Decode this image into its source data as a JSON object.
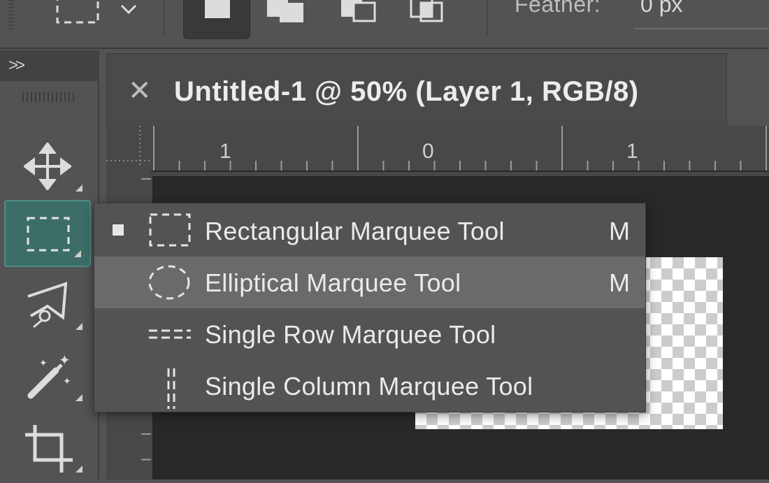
{
  "options_bar": {
    "feather_label": "Feather:",
    "feather_value": "0 px"
  },
  "toolbar": {
    "collapse_toggle": ">>"
  },
  "document": {
    "close_glyph": "✕",
    "title": "Untitled-1 @ 50% (Layer 1, RGB/8)",
    "ruler_labels": [
      "1",
      "0",
      "1"
    ]
  },
  "flyout": {
    "items": [
      {
        "label": "Rectangular Marquee Tool",
        "shortcut": "M",
        "icon": "rect-marquee-icon",
        "active": true
      },
      {
        "label": "Elliptical Marquee Tool",
        "shortcut": "M",
        "icon": "ellipse-marquee-icon",
        "highlighted": true
      },
      {
        "label": "Single Row Marquee Tool",
        "shortcut": "",
        "icon": "single-row-marquee-icon"
      },
      {
        "label": "Single Column Marquee Tool",
        "shortcut": "",
        "icon": "single-column-marquee-icon"
      }
    ]
  },
  "colors": {
    "selected_tool_bg": "#3c6e67",
    "menu_highlight": "#6a6a6a",
    "panel_bg": "#535353"
  }
}
